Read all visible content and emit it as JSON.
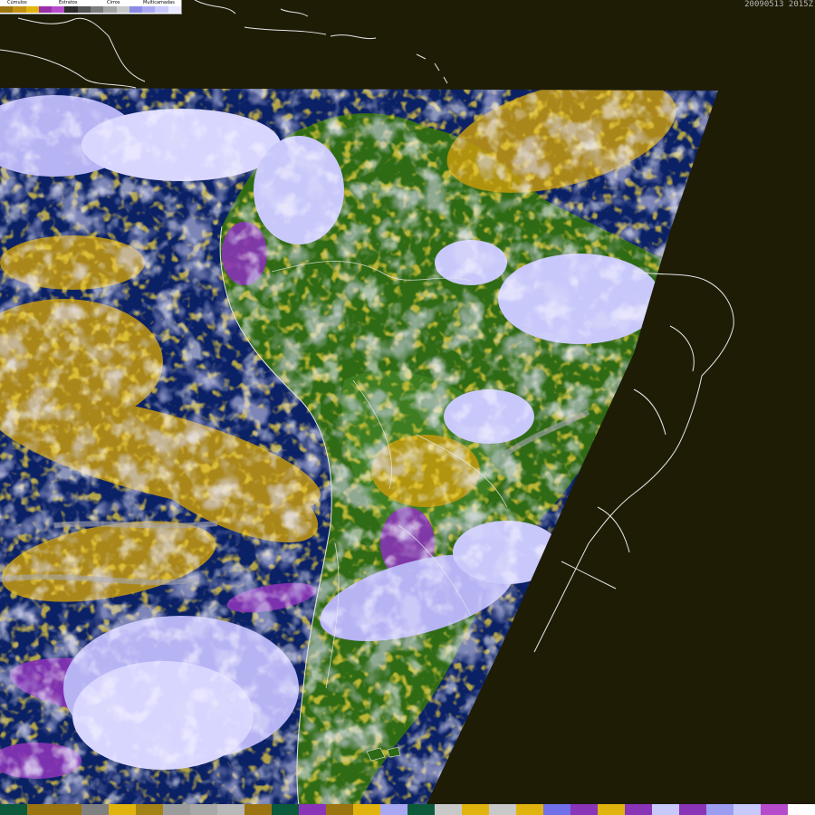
{
  "image": {
    "timestamp": "20090513  2015Z",
    "colors": {
      "background": "#1e1c05",
      "ocean": "#0b2166",
      "land": "#2f6a14",
      "land_light": "#3f7d22",
      "cumulus_gold": "#d2a00a",
      "cumulus_dark": "#9a7410",
      "stratus_purple": "#8a34b8",
      "stratus_magenta": "#b64ccc",
      "cirrus_gray": "#a8a8b6",
      "multilayer_lavender": "#b7b4f4",
      "bright_white": "#eceaff",
      "coastline": "#e6e6e6"
    }
  },
  "legend": {
    "labels": [
      "Cúmulos",
      "Estratos",
      "Cirros",
      "Multicamadas"
    ],
    "swatches": [
      "#9a7410",
      "#c49012",
      "#e0b40c",
      "#9a2fa8",
      "#b64ccc",
      "#2c2c2c",
      "#555555",
      "#7c7c7c",
      "#a4a4a4",
      "#c8c8c8",
      "#8a8ae6",
      "#a8a8f2",
      "#c8c8fb",
      "#e8e8ff"
    ]
  },
  "bottom_bar": {
    "swatches": [
      "#0c5a3c",
      "#9a7410",
      "#9a7410",
      "#808080",
      "#e0b40c",
      "#a48316",
      "#9c9c9c",
      "#a8a8a8",
      "#b8b8b8",
      "#9a7410",
      "#0c5a3c",
      "#8a34b8",
      "#9a7410",
      "#e0b40c",
      "#a8a8f2",
      "#0c5a3c",
      "#c8c8c8",
      "#e0b40c",
      "#c8c8c8",
      "#e0b40c",
      "#7070e8",
      "#8a34b8",
      "#e0b40c",
      "#8a34b8",
      "#c8c8fb",
      "#8a34b8",
      "#9c9cf0",
      "#c8c8fb",
      "#b64ccc",
      "#ffffff"
    ]
  }
}
